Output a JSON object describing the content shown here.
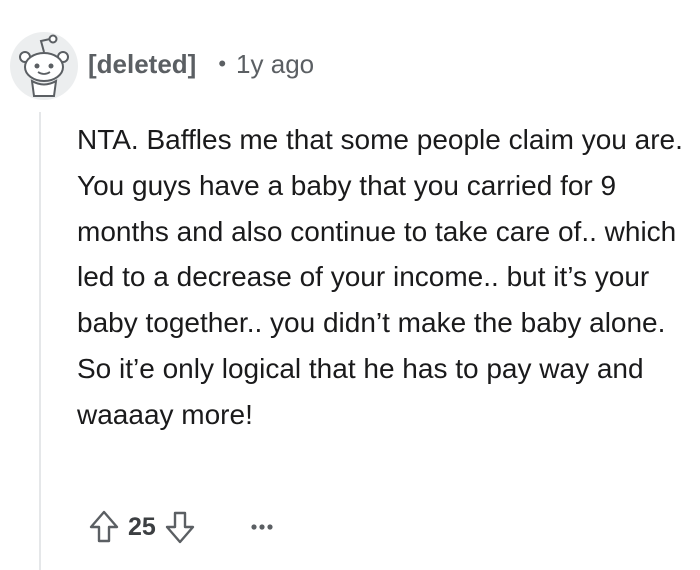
{
  "comment": {
    "author": "[deleted]",
    "separator": "•",
    "timestamp": "1y ago",
    "body": "NTA. Baffles me that some people claim you are. You guys have a baby that you carried for 9 months and also continue to take care of.. which led to a decrease of your income.. but it’s your baby together.. you didn’t make the baby alone. So it’e only logical that he has to pay way and waaaay more!",
    "score": "25",
    "upvote_icon": "upvote-arrow-icon",
    "downvote_icon": "downvote-arrow-icon",
    "more_icon": "more-options-icon",
    "avatar_icon": "deleted-user-snoo-icon"
  },
  "colors": {
    "meta_text": "#5b5f63",
    "body_text": "#1a1a1b",
    "thread_line": "#e5e7e9",
    "icon": "#5b5f63"
  }
}
